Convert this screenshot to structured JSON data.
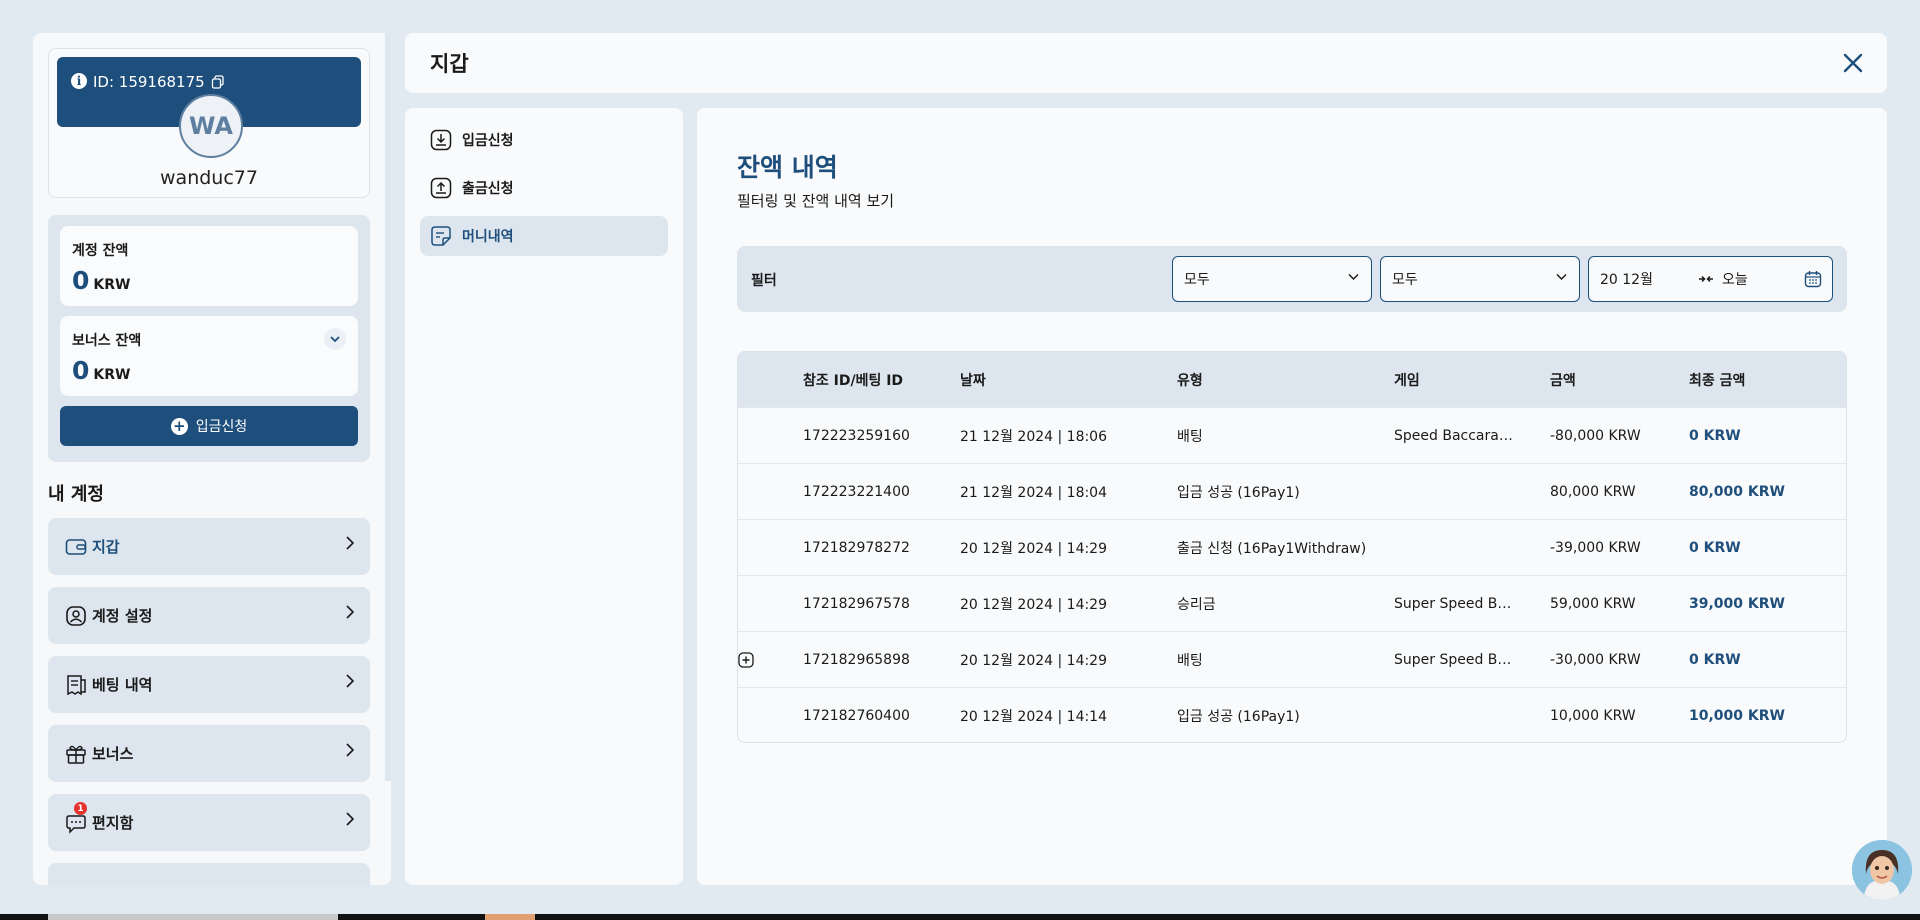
{
  "profile": {
    "id_label": "ID: 159168175",
    "initials": "WA",
    "username": "wanduc77"
  },
  "balances": {
    "account_label": "계정 잔액",
    "account_value": "0",
    "account_currency": "KRW",
    "bonus_label": "보너스 잔액",
    "bonus_value": "0",
    "bonus_currency": "KRW",
    "deposit_button": "입금신청"
  },
  "sidebar": {
    "section_title": "내 계정",
    "items": [
      {
        "label": "지갑",
        "icon": "wallet-icon",
        "active": true
      },
      {
        "label": "계정 설정",
        "icon": "user-settings-icon"
      },
      {
        "label": "베팅 내역",
        "icon": "receipt-icon"
      },
      {
        "label": "보너스",
        "icon": "gift-icon"
      },
      {
        "label": "편지함",
        "icon": "message-icon",
        "badge": "1"
      }
    ]
  },
  "header": {
    "title": "지갑"
  },
  "submenu": {
    "items": [
      {
        "label": "입금신청",
        "icon": "download-icon"
      },
      {
        "label": "출금신청",
        "icon": "upload-icon"
      },
      {
        "label": "머니내역",
        "icon": "document-icon",
        "active": true
      }
    ]
  },
  "main": {
    "title": "잔액 내역",
    "subtitle": "필터링 및 잔액 내역 보기"
  },
  "filter": {
    "label": "필터",
    "select1": "모두",
    "select2": "모두",
    "date_from": "20 12월",
    "date_to": "오늘"
  },
  "table": {
    "headers": [
      "참조 ID/베팅 ID",
      "날짜",
      "유형",
      "게임",
      "금액",
      "최종 금액"
    ],
    "rows": [
      {
        "ref": "172223259160",
        "date": "21 12월 2024 | 18:06",
        "type": "배팅",
        "game": "Speed Baccarat Z",
        "amount": "-80,000 KRW",
        "final": "0 KRW"
      },
      {
        "ref": "172223221400",
        "date": "21 12월 2024 | 18:04",
        "type": "입금 성공 (16Pay1)",
        "game": "",
        "amount": "80,000 KRW",
        "final": "80,000 KRW"
      },
      {
        "ref": "172182978272",
        "date": "20 12월 2024 | 14:29",
        "type": "출금 신청 (16Pay1Withdraw)",
        "game": "",
        "amount": "-39,000 KRW",
        "final": "0 KRW"
      },
      {
        "ref": "172182967578",
        "date": "20 12월 2024 | 14:29",
        "type": "승리금",
        "game": "Super Speed Ba…",
        "amount": "59,000 KRW",
        "final": "39,000 KRW"
      },
      {
        "ref": "172182965898",
        "date": "20 12월 2024 | 14:29",
        "type": "배팅",
        "game": "Super Speed Ba…",
        "amount": "-30,000 KRW",
        "final": "0 KRW",
        "expandable": true
      },
      {
        "ref": "172182760400",
        "date": "20 12월 2024 | 14:14",
        "type": "입금 성공 (16Pay1)",
        "game": "",
        "amount": "10,000 KRW",
        "final": "10,000 KRW"
      }
    ]
  },
  "colors": {
    "primary": "#1e4f7c",
    "panel": "#dde6ee",
    "background": "#e2eaf1",
    "badge": "#e5322d"
  }
}
